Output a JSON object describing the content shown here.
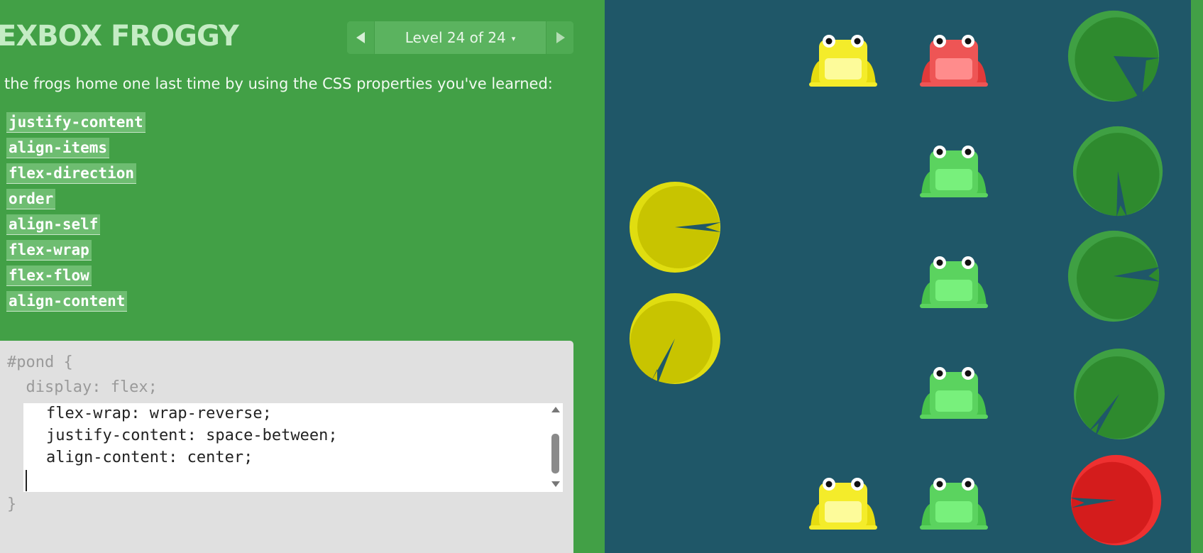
{
  "header": {
    "title": "EXBOX FROGGY",
    "level_label": "Level 24 of 24",
    "caret": "▾"
  },
  "instructions": "the frogs home one last time by using the CSS properties you've learned:",
  "properties": [
    "justify-content",
    "align-items",
    "flex-direction",
    "order",
    "align-self",
    "flex-wrap",
    "flex-flow",
    "align-content"
  ],
  "editor": {
    "line1": "#pond {",
    "line2": "  display: flex;",
    "input_lines": [
      "flex-wrap: wrap-reverse;",
      "justify-content: space-between;",
      "align-content: center;"
    ],
    "closing": "}"
  },
  "colors": {
    "green_bg": "#42a046",
    "pond": "#1f5768",
    "green_pad": "#2e8a2e",
    "yellow_pad": "#c8c400",
    "red_pad": "#d41c1c",
    "green_frog": "#5bd35f",
    "yellow_frog": "#f4ec2a",
    "red_frog": "#ee5555"
  },
  "pond": {
    "frogs": [
      "yellow",
      "red",
      "green",
      "green",
      "green",
      "yellow",
      "green"
    ],
    "lilypads": [
      "yellow",
      "yellow",
      "green",
      "green",
      "green",
      "green",
      "red"
    ]
  }
}
